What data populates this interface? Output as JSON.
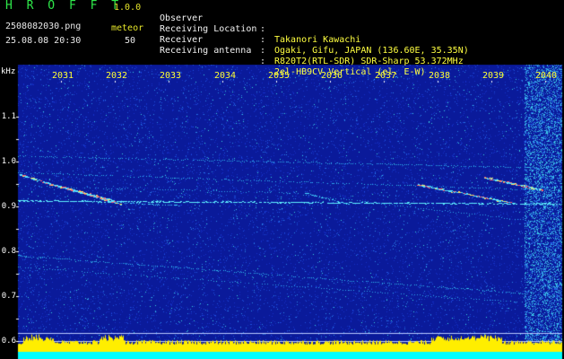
{
  "app": {
    "title": "H R O F F T",
    "version": "1.0.0"
  },
  "file": {
    "name": "2508082030.png",
    "datetime": "25.08.08 20:30"
  },
  "meteor": {
    "label": "meteor",
    "count": "50"
  },
  "info": [
    {
      "label": "Observer",
      "value": "Takanori Kawachi"
    },
    {
      "label": "Receiving Location",
      "value": "Ogaki, Gifu, JAPAN (136.60E, 35.35N)"
    },
    {
      "label": "Receiver",
      "value": "R820T2(RTL-SDR) SDR-Sharp 53.372MHz"
    },
    {
      "label": "Receiving antenna",
      "value": "2el-HB9CV Vertical (el. E-W)"
    }
  ],
  "axis": {
    "unit": "kHz",
    "y_ticks": [
      "1.1",
      "1.0",
      "0.9",
      "0.8",
      "0.7",
      "0.6"
    ],
    "x_ticks": [
      "2031",
      "2032",
      "2033",
      "2034",
      "2035",
      "2036",
      "2037",
      "2038",
      "2039",
      "2040"
    ]
  },
  "colors": {
    "background": "#000000",
    "plot_bg": "#0a1a9a",
    "text": "#ffffff",
    "accent_yellow": "#ffff33",
    "title_green": "#2ee84a",
    "signal": "#55e6ff",
    "meteor_head": "#ff5060",
    "baseline": "#ffee00",
    "baseline_top": "#00ffff"
  }
}
